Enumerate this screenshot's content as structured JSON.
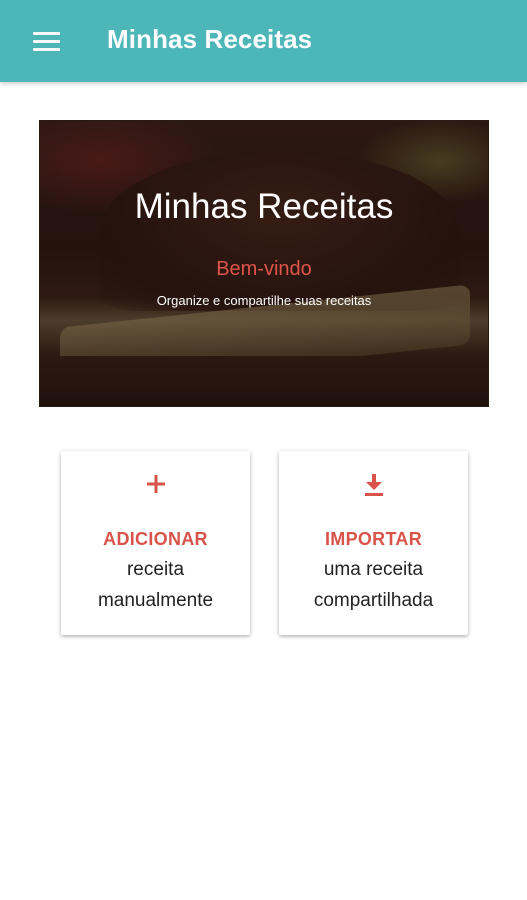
{
  "appbar": {
    "title": "Minhas Receitas",
    "menu_icon": "hamburger-menu-icon",
    "background_color": "#4db6b9"
  },
  "hero": {
    "title": "Minhas Receitas",
    "welcome": "Bem-vindo",
    "subtitle": "Organize e compartilhe suas receitas",
    "image": "chocolate-cake-slice-photo"
  },
  "actions": {
    "add": {
      "icon": "plus-icon",
      "heading": "ADICIONAR",
      "line1": "receita",
      "line2": "manualmente"
    },
    "import": {
      "icon": "download-icon",
      "heading": "IMPORTAR",
      "line1": "uma receita",
      "line2": "compartilhada"
    }
  },
  "colors": {
    "accent": "#d9534a",
    "welcome": "#e0544a"
  }
}
